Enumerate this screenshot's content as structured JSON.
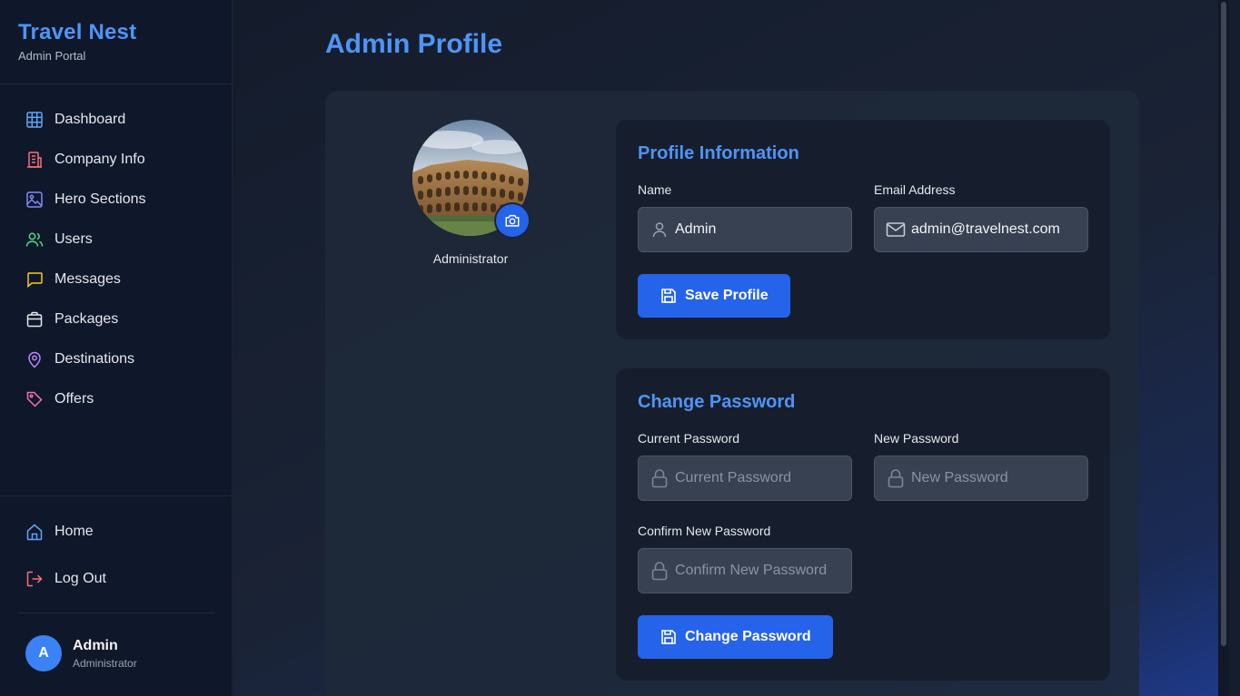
{
  "sidebar": {
    "brand_title": "Travel Nest",
    "brand_subtitle": "Admin Portal",
    "items": [
      {
        "label": "Dashboard",
        "icon": "grid-icon",
        "color": "#60a5fa"
      },
      {
        "label": "Company Info",
        "icon": "building-icon",
        "color": "#f87171"
      },
      {
        "label": "Hero Sections",
        "icon": "image-icon",
        "color": "#818cf8"
      },
      {
        "label": "Users",
        "icon": "users-icon",
        "color": "#4ade80"
      },
      {
        "label": "Messages",
        "icon": "message-icon",
        "color": "#facc15"
      },
      {
        "label": "Packages",
        "icon": "package-icon",
        "color": "#e5e7eb"
      },
      {
        "label": "Destinations",
        "icon": "map-pin-icon",
        "color": "#c084fc"
      },
      {
        "label": "Offers",
        "icon": "tag-icon",
        "color": "#f472b6"
      }
    ],
    "bottom": [
      {
        "label": "Home",
        "icon": "home-icon",
        "color": "#60a5fa"
      },
      {
        "label": "Log Out",
        "icon": "log-out-icon",
        "color": "#f87171"
      }
    ],
    "user": {
      "initial": "A",
      "name": "Admin",
      "role": "Administrator"
    }
  },
  "main": {
    "page_title": "Admin Profile",
    "photo": {
      "caption": "Administrator",
      "camera_icon": "camera-icon"
    },
    "profile_card": {
      "title": "Profile Information",
      "name_label": "Name",
      "name_value": "Admin",
      "email_label": "Email Address",
      "email_value": "admin@travelnest.com",
      "save_label": "Save Profile"
    },
    "password_card": {
      "title": "Change Password",
      "current_label": "Current Password",
      "current_placeholder": "Current Password",
      "new_label": "New Password",
      "new_placeholder": "New Password",
      "confirm_label": "Confirm New Password",
      "confirm_placeholder": "Confirm New Password",
      "submit_label": "Change Password"
    }
  },
  "colors": {
    "accent": "#4e95f7",
    "button": "#2563eb",
    "sidebar_bg": "#0f172a"
  }
}
